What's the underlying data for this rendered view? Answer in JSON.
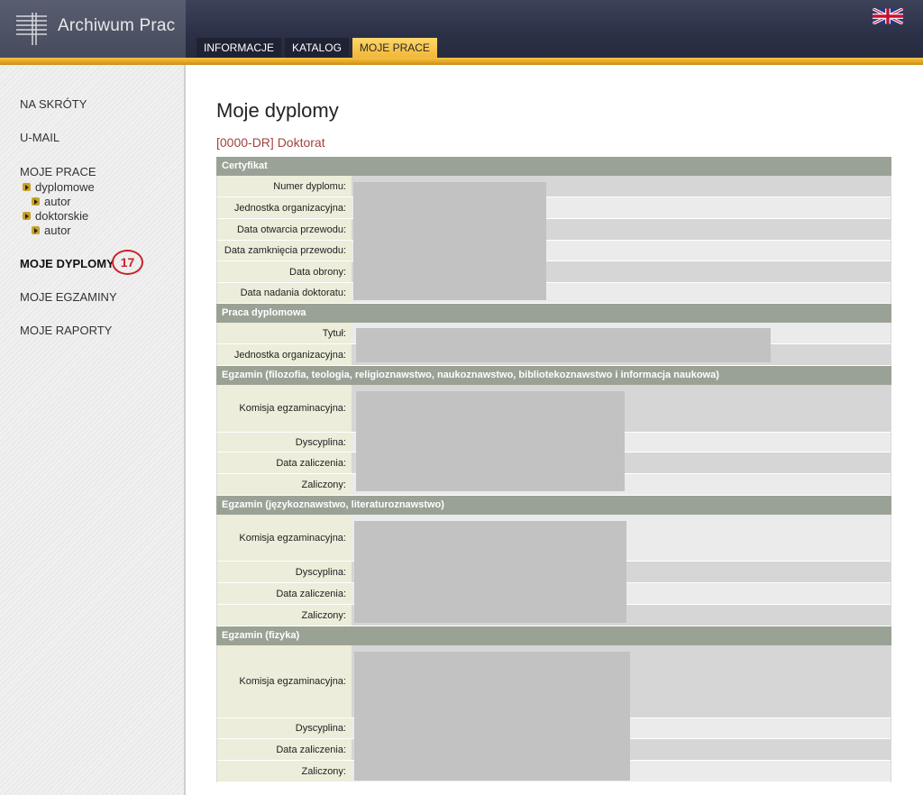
{
  "header": {
    "app_title": "Archiwum Prac",
    "tabs": [
      {
        "label": "INFORMACJE",
        "active": false
      },
      {
        "label": "KATALOG",
        "active": false
      },
      {
        "label": "MOJE PRACE",
        "active": true
      }
    ],
    "language_icon": "uk-flag-icon"
  },
  "sidebar": {
    "items": [
      {
        "label": "NA SKRÓTY"
      },
      {
        "label": "U-MAIL"
      },
      {
        "label": "MOJE PRACE"
      },
      {
        "label": "MOJE DYPLOMY",
        "active": true
      },
      {
        "label": "MOJE EGZAMINY"
      },
      {
        "label": "MOJE RAPORTY"
      }
    ],
    "sub_items": [
      {
        "label": "dyplomowe"
      },
      {
        "label": "autor"
      },
      {
        "label": "doktorskie"
      },
      {
        "label": "autor"
      }
    ],
    "badge": "17"
  },
  "main": {
    "title": "Moje dyplomy",
    "subtitle": "[0000-DR] Doktorat",
    "sections": [
      {
        "title": "Certyfikat",
        "labels": [
          "Numer dyplomu:",
          "Jednostka organizacyjna:",
          "Data otwarcia przewodu:",
          "Data zamknięcia przewodu:",
          "Data obrony:",
          "Data nadania doktoratu:"
        ]
      },
      {
        "title": "Praca dyplomowa",
        "labels": [
          "Tytuł:",
          "Jednostka organizacyjna:"
        ]
      },
      {
        "title": "Egzamin (filozofia, teologia, religioznawstwo, naukoznawstwo, bibliotekoznawstwo i informacja naukowa)",
        "labels": [
          "Komisja egzaminacyjna:",
          "Dyscyplina:",
          "Data zaliczenia:",
          "Zaliczony:"
        ]
      },
      {
        "title": "Egzamin (językoznawstwo, literaturoznawstwo)",
        "labels": [
          "Komisja egzaminacyjna:",
          "Dyscyplina:",
          "Data zaliczenia:",
          "Zaliczony:"
        ]
      },
      {
        "title": "Egzamin (fizyka)",
        "labels": [
          "Komisja egzaminacyjna:",
          "Dyscyplina:",
          "Data zaliczenia:",
          "Zaliczony:"
        ]
      }
    ]
  },
  "colors": {
    "accent_gold": "#f2b636",
    "header_navy": "#2b3046",
    "section_header": "#9aa295",
    "label_bg": "#ecedda",
    "subtitle_red": "#a0433f",
    "badge_red": "#c8222a"
  }
}
